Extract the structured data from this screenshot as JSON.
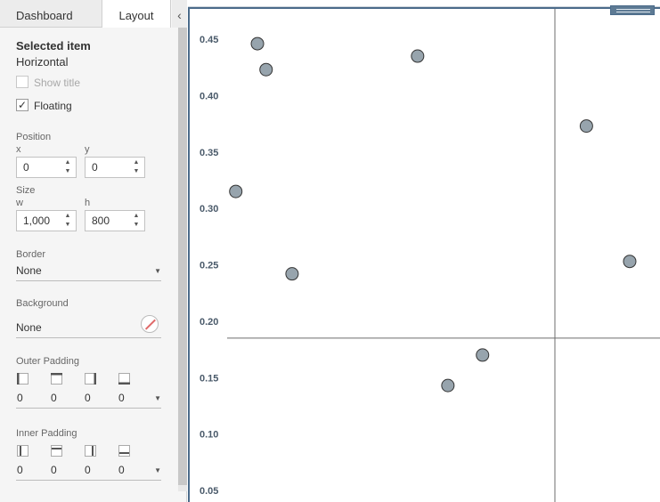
{
  "tabs": [
    {
      "label": "Dashboard",
      "active": false
    },
    {
      "label": "Layout",
      "active": true
    }
  ],
  "collapse_icon": "chevron-left-icon",
  "selected_item": {
    "title": "Selected item",
    "value": "Horizontal"
  },
  "show_title": {
    "label": "Show title",
    "checked": false,
    "disabled": true
  },
  "floating": {
    "label": "Floating",
    "checked": true
  },
  "position": {
    "label": "Position",
    "x": {
      "label": "x",
      "value": "0"
    },
    "y": {
      "label": "y",
      "value": "0"
    }
  },
  "size": {
    "label": "Size",
    "w": {
      "label": "w",
      "value": "1,000"
    },
    "h": {
      "label": "h",
      "value": "800"
    }
  },
  "border": {
    "label": "Border",
    "value": "None"
  },
  "background": {
    "label": "Background",
    "value": "None"
  },
  "outer_padding": {
    "label": "Outer Padding",
    "values": [
      "0",
      "0",
      "0",
      "0"
    ]
  },
  "inner_padding": {
    "label": "Inner Padding",
    "values": [
      "0",
      "0",
      "0",
      "0"
    ]
  },
  "colors": {
    "frame": "#4b6b8a",
    "point_fill": "#97a4ad",
    "point_stroke": "#333333",
    "refline": "#6e6e6e"
  },
  "chart_data": {
    "type": "scatter",
    "y_ticks": [
      "0.45",
      "0.40",
      "0.35",
      "0.30",
      "0.25",
      "0.20",
      "0.15",
      "0.10",
      "0.05"
    ],
    "ylim": [
      0.05,
      0.45
    ],
    "grid": false,
    "reference_lines": {
      "y": 0.185
    },
    "points": [
      {
        "x": 0.02,
        "y": 0.315
      },
      {
        "x": 0.07,
        "y": 0.446
      },
      {
        "x": 0.09,
        "y": 0.423
      },
      {
        "x": 0.15,
        "y": 0.242
      },
      {
        "x": 0.44,
        "y": 0.435
      },
      {
        "x": 0.51,
        "y": 0.143
      },
      {
        "x": 0.59,
        "y": 0.17
      },
      {
        "x": 0.83,
        "y": 0.373
      },
      {
        "x": 0.93,
        "y": 0.253
      }
    ]
  }
}
